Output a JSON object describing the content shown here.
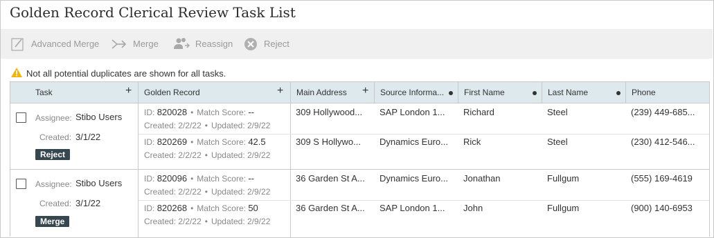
{
  "title": "Golden Record Clerical Review Task List",
  "toolbar": {
    "advanced_merge": "Advanced Merge",
    "merge": "Merge",
    "reassign": "Reassign",
    "reject": "Reject"
  },
  "warning": "Not all potential duplicates are shown for all tasks.",
  "columns": {
    "task": "Task",
    "golden_record": "Golden Record",
    "main_address": "Main Address",
    "source_info": "Source Informa...",
    "first_name": "First Name",
    "last_name": "Last Name",
    "phone": "Phone"
  },
  "labels": {
    "assignee": "Assignee:",
    "created": "Created:",
    "id": "ID:",
    "match_score": "Match Score:",
    "created_gr": "Created:",
    "updated": "Updated:"
  },
  "tasks": [
    {
      "assignee": "Stibo Users",
      "created": "3/1/22",
      "action": "Reject",
      "records": [
        {
          "id": "820028",
          "match_score": "--",
          "created": "2/2/22",
          "updated": "2/9/22",
          "address": "309 Hollywood...",
          "source": "SAP London 1...",
          "first": "Richard",
          "last": "Steel",
          "phone": "(239) 449-685..."
        },
        {
          "id": "820269",
          "match_score": "42.5",
          "created": "2/2/22",
          "updated": "2/9/22",
          "address": "309 S Hollywo...",
          "source": "Dynamics Euro...",
          "first": "Rick",
          "last": "Steel",
          "phone": "(230) 412-546..."
        }
      ]
    },
    {
      "assignee": "Stibo Users",
      "created": "3/1/22",
      "action": "Merge",
      "records": [
        {
          "id": "820096",
          "match_score": "--",
          "created": "2/2/22",
          "updated": "2/9/22",
          "address": "36 Garden St A...",
          "source": "Dynamics Euro...",
          "first": "Jonathan",
          "last": "Fullgum",
          "phone": "(555) 169-4619"
        },
        {
          "id": "820268",
          "match_score": "50",
          "created": "2/2/22",
          "updated": "2/9/22",
          "address": "36 Garden St A...",
          "source": "SAP London 1...",
          "first": "John",
          "last": "Fullgum",
          "phone": "(900) 140-6953"
        }
      ]
    }
  ]
}
